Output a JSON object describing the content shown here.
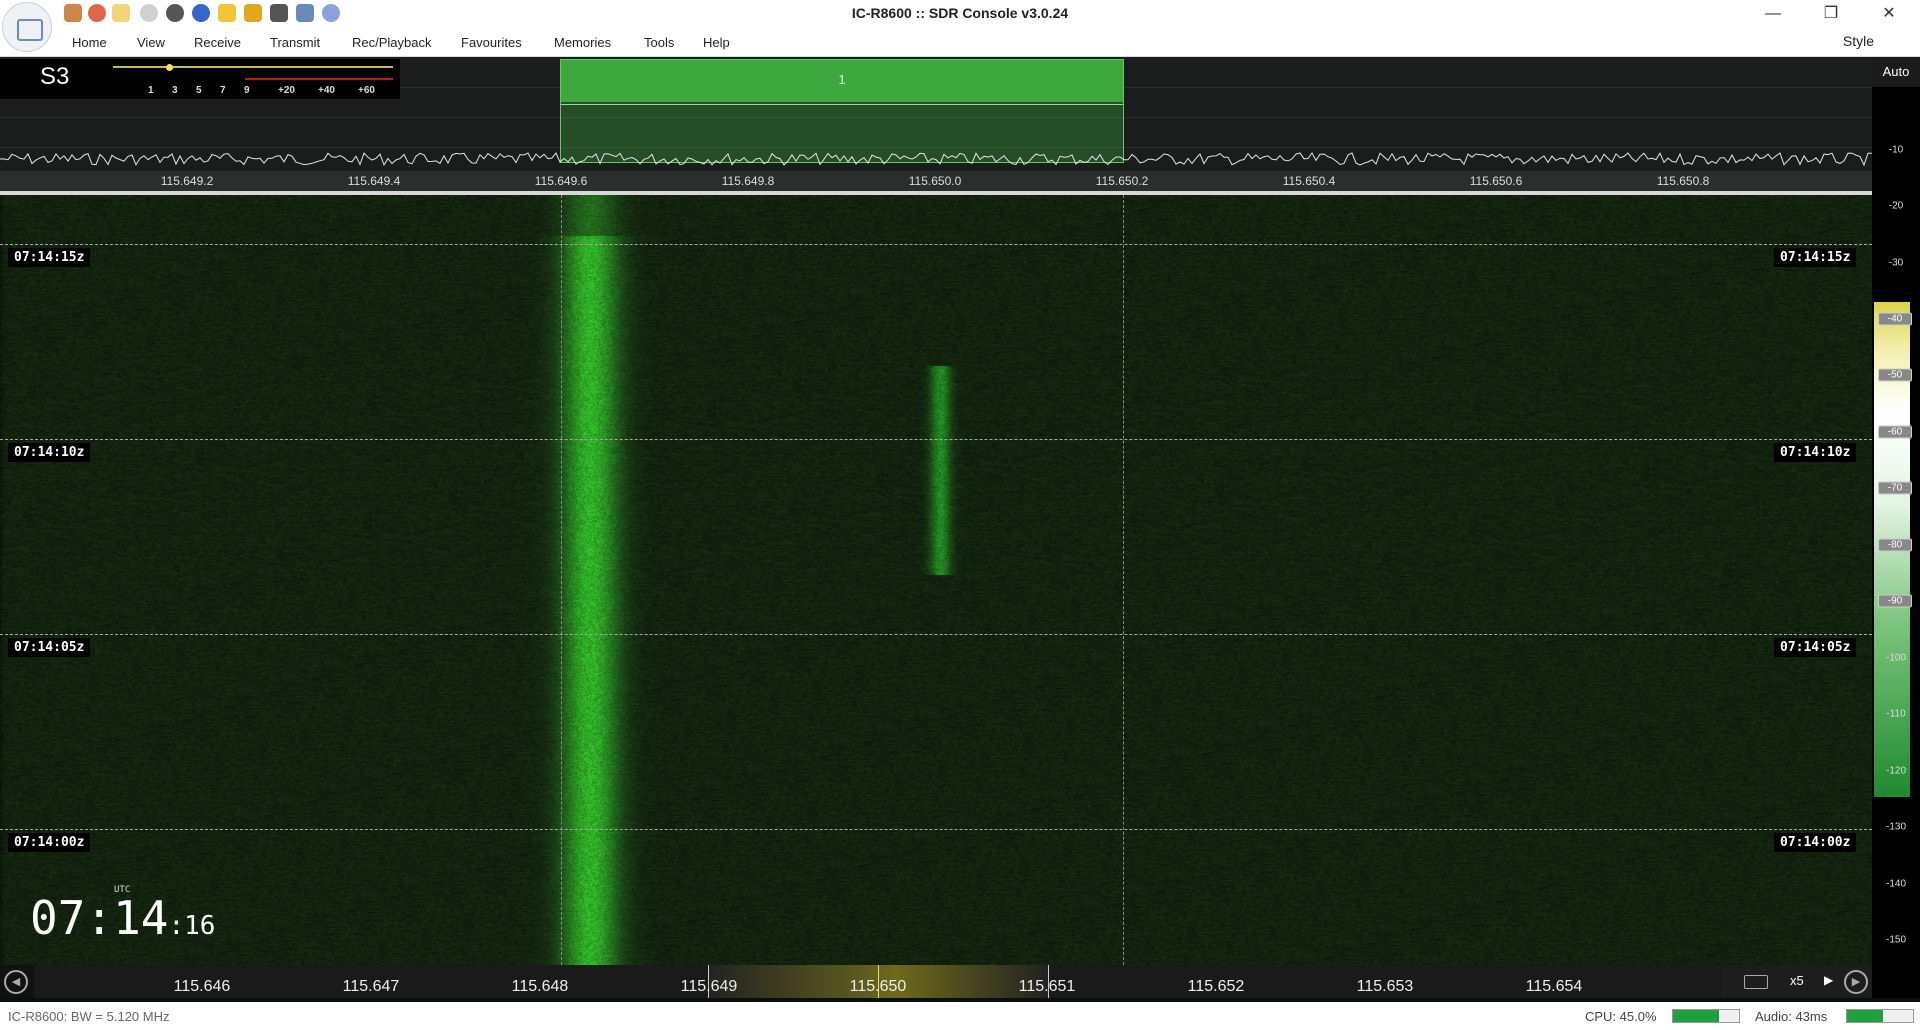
{
  "window": {
    "title": "IC-R8600 :: SDR Console v3.0.24",
    "minimize": "—",
    "restore": "❐",
    "close": "✕"
  },
  "menu": {
    "items": [
      "Home",
      "View",
      "Receive",
      "Transmit",
      "Rec/Playback",
      "Favourites",
      "Memories",
      "Tools",
      "Help"
    ],
    "style_label": "Style"
  },
  "smeter": {
    "value": "S3",
    "scale": [
      "1",
      "3",
      "5",
      "7",
      "9",
      "+20",
      "+40",
      "+60"
    ]
  },
  "spectrum": {
    "filter_label": "1",
    "freq_ticks": [
      "115.649.2",
      "115.649.4",
      "115.649.6",
      "115.649.8",
      "115.650.0",
      "115.650.2",
      "115.650.4",
      "115.650.6",
      "115.650.8"
    ]
  },
  "waterfall": {
    "timestamps": [
      "07:14:15z",
      "07:14:10z",
      "07:14:05z",
      "07:14:00z"
    ]
  },
  "clock": {
    "utc_label": "UTC",
    "time_main": "07:14",
    "time_sec": ":16"
  },
  "colorbar": {
    "auto_label": "Auto",
    "db_labels": [
      "-10",
      "-20",
      "-30",
      "-40",
      "-50",
      "-60",
      "-70",
      "-80",
      "-90",
      "-100",
      "-110",
      "-120",
      "-130",
      "-140",
      "-150"
    ],
    "boxed_labels": [
      "-40",
      "-50",
      "-60",
      "-70",
      "-80",
      "-90"
    ]
  },
  "ruler": {
    "labels": [
      "115.646",
      "115.647",
      "115.648",
      "115.649",
      "115.650",
      "115.651",
      "115.652",
      "115.653",
      "115.654"
    ],
    "zoom": "x5"
  },
  "status": {
    "left": "IC-R8600: BW = 5.120 MHz",
    "cpu": "CPU: 45.0%",
    "cpu_fraction": 0.7,
    "audio": "Audio: 43ms",
    "audio_fraction": 0.55
  },
  "colors": {
    "signal": "#3fc83f",
    "filter": "#3da83d"
  }
}
